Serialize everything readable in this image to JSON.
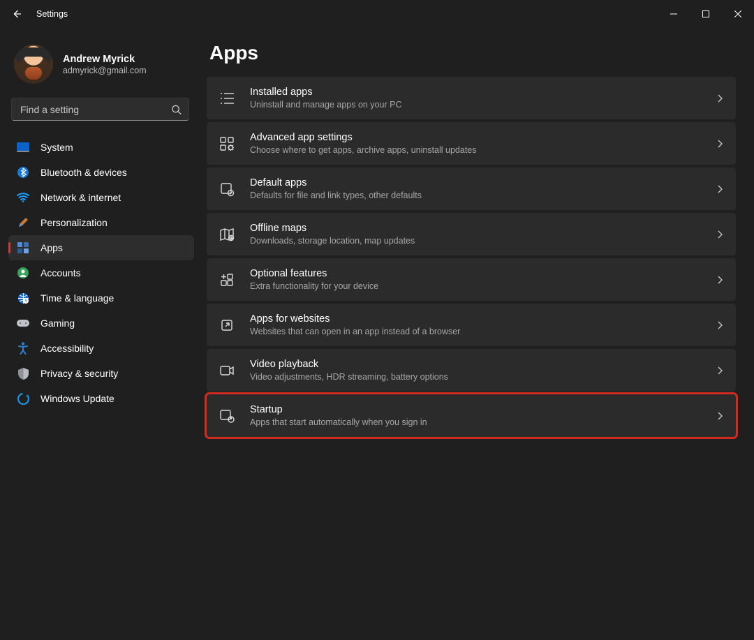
{
  "window": {
    "title": "Settings"
  },
  "profile": {
    "name": "Andrew Myrick",
    "email": "admyrick@gmail.com"
  },
  "search": {
    "placeholder": "Find a setting"
  },
  "page": {
    "title": "Apps"
  },
  "sidebar": {
    "items": [
      {
        "label": "System"
      },
      {
        "label": "Bluetooth & devices"
      },
      {
        "label": "Network & internet"
      },
      {
        "label": "Personalization"
      },
      {
        "label": "Apps"
      },
      {
        "label": "Accounts"
      },
      {
        "label": "Time & language"
      },
      {
        "label": "Gaming"
      },
      {
        "label": "Accessibility"
      },
      {
        "label": "Privacy & security"
      },
      {
        "label": "Windows Update"
      }
    ],
    "activeIndex": 4
  },
  "cards": [
    {
      "title": "Installed apps",
      "sub": "Uninstall and manage apps on your PC"
    },
    {
      "title": "Advanced app settings",
      "sub": "Choose where to get apps, archive apps, uninstall updates"
    },
    {
      "title": "Default apps",
      "sub": "Defaults for file and link types, other defaults"
    },
    {
      "title": "Offline maps",
      "sub": "Downloads, storage location, map updates"
    },
    {
      "title": "Optional features",
      "sub": "Extra functionality for your device"
    },
    {
      "title": "Apps for websites",
      "sub": "Websites that can open in an app instead of a browser"
    },
    {
      "title": "Video playback",
      "sub": "Video adjustments, HDR streaming, battery options"
    },
    {
      "title": "Startup",
      "sub": "Apps that start automatically when you sign in",
      "highlight": true
    }
  ]
}
